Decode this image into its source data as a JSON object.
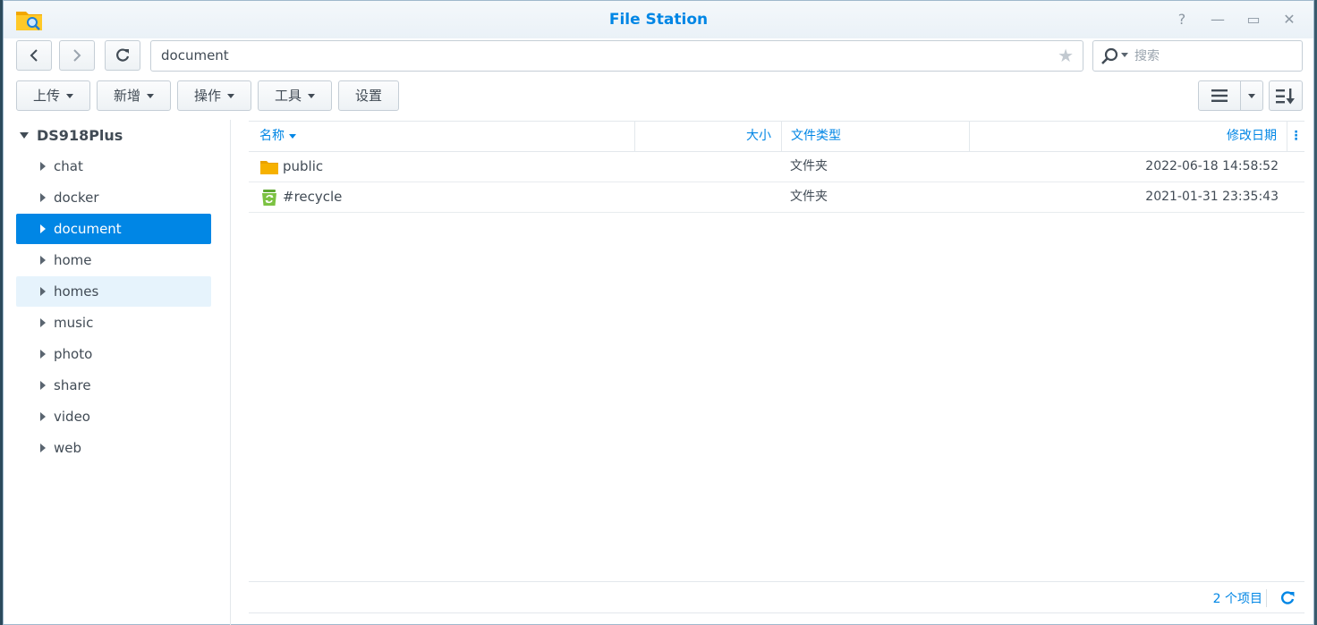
{
  "window": {
    "title": "File Station",
    "help_symbol": "?",
    "min_symbol": "—",
    "max_symbol": "▭",
    "close_symbol": "✕"
  },
  "nav": {
    "path": "document",
    "search_placeholder": "搜索",
    "star_symbol": "★"
  },
  "toolbar": {
    "upload": "上传",
    "create": "新增",
    "action": "操作",
    "tools": "工具",
    "settings": "设置"
  },
  "sidebar": {
    "root": "DS918Plus",
    "items": [
      {
        "label": "chat"
      },
      {
        "label": "docker"
      },
      {
        "label": "document"
      },
      {
        "label": "home"
      },
      {
        "label": "homes"
      },
      {
        "label": "music"
      },
      {
        "label": "photo"
      },
      {
        "label": "share"
      },
      {
        "label": "video"
      },
      {
        "label": "web"
      }
    ]
  },
  "grid": {
    "columns": {
      "name": "名称",
      "size": "大小",
      "type": "文件类型",
      "date": "修改日期",
      "more": "⋮"
    },
    "rows": [
      {
        "name": "public",
        "size": "",
        "type": "文件夹",
        "date": "2022-06-18 14:58:52",
        "icon": "folder-icon"
      },
      {
        "name": "#recycle",
        "size": "",
        "type": "文件夹",
        "date": "2021-01-31 23:35:43",
        "icon": "recycle-bin-icon"
      }
    ]
  },
  "status": {
    "count": "2 个项目"
  },
  "colors": {
    "accent": "#0086e5",
    "selected_bg": "#0086e5",
    "hover_bg": "#e6f3fc",
    "folder": "#f6b100",
    "recycle": "#7cc242"
  }
}
